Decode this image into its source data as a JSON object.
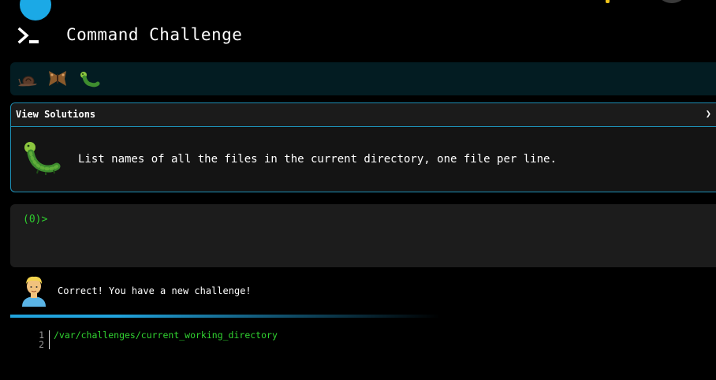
{
  "header": {
    "title": "Command Challenge",
    "logo_icon": "terminal-prompt-icon"
  },
  "badges": [
    "snail-icon",
    "butterfly-icon",
    "caterpillar-icon"
  ],
  "challenge": {
    "view_solutions_label": "View Solutions",
    "expand_glyph": "❯",
    "icon": "caterpillar-icon",
    "description": "List names of all the files in the current directory, one file per line."
  },
  "terminal": {
    "prompt": "(0)>"
  },
  "feedback": {
    "avatar_icon": "person-avatar-icon",
    "message": "Correct! You have a new challenge!"
  },
  "editor": {
    "line_numbers": [
      "1",
      "2"
    ],
    "lines": [
      "/var/challenges/current_working_directory",
      ""
    ]
  },
  "colors": {
    "accent": "#1e8fb5",
    "prompt_green": "#2fcf2f",
    "badge_bar_bg": "#031c22"
  }
}
